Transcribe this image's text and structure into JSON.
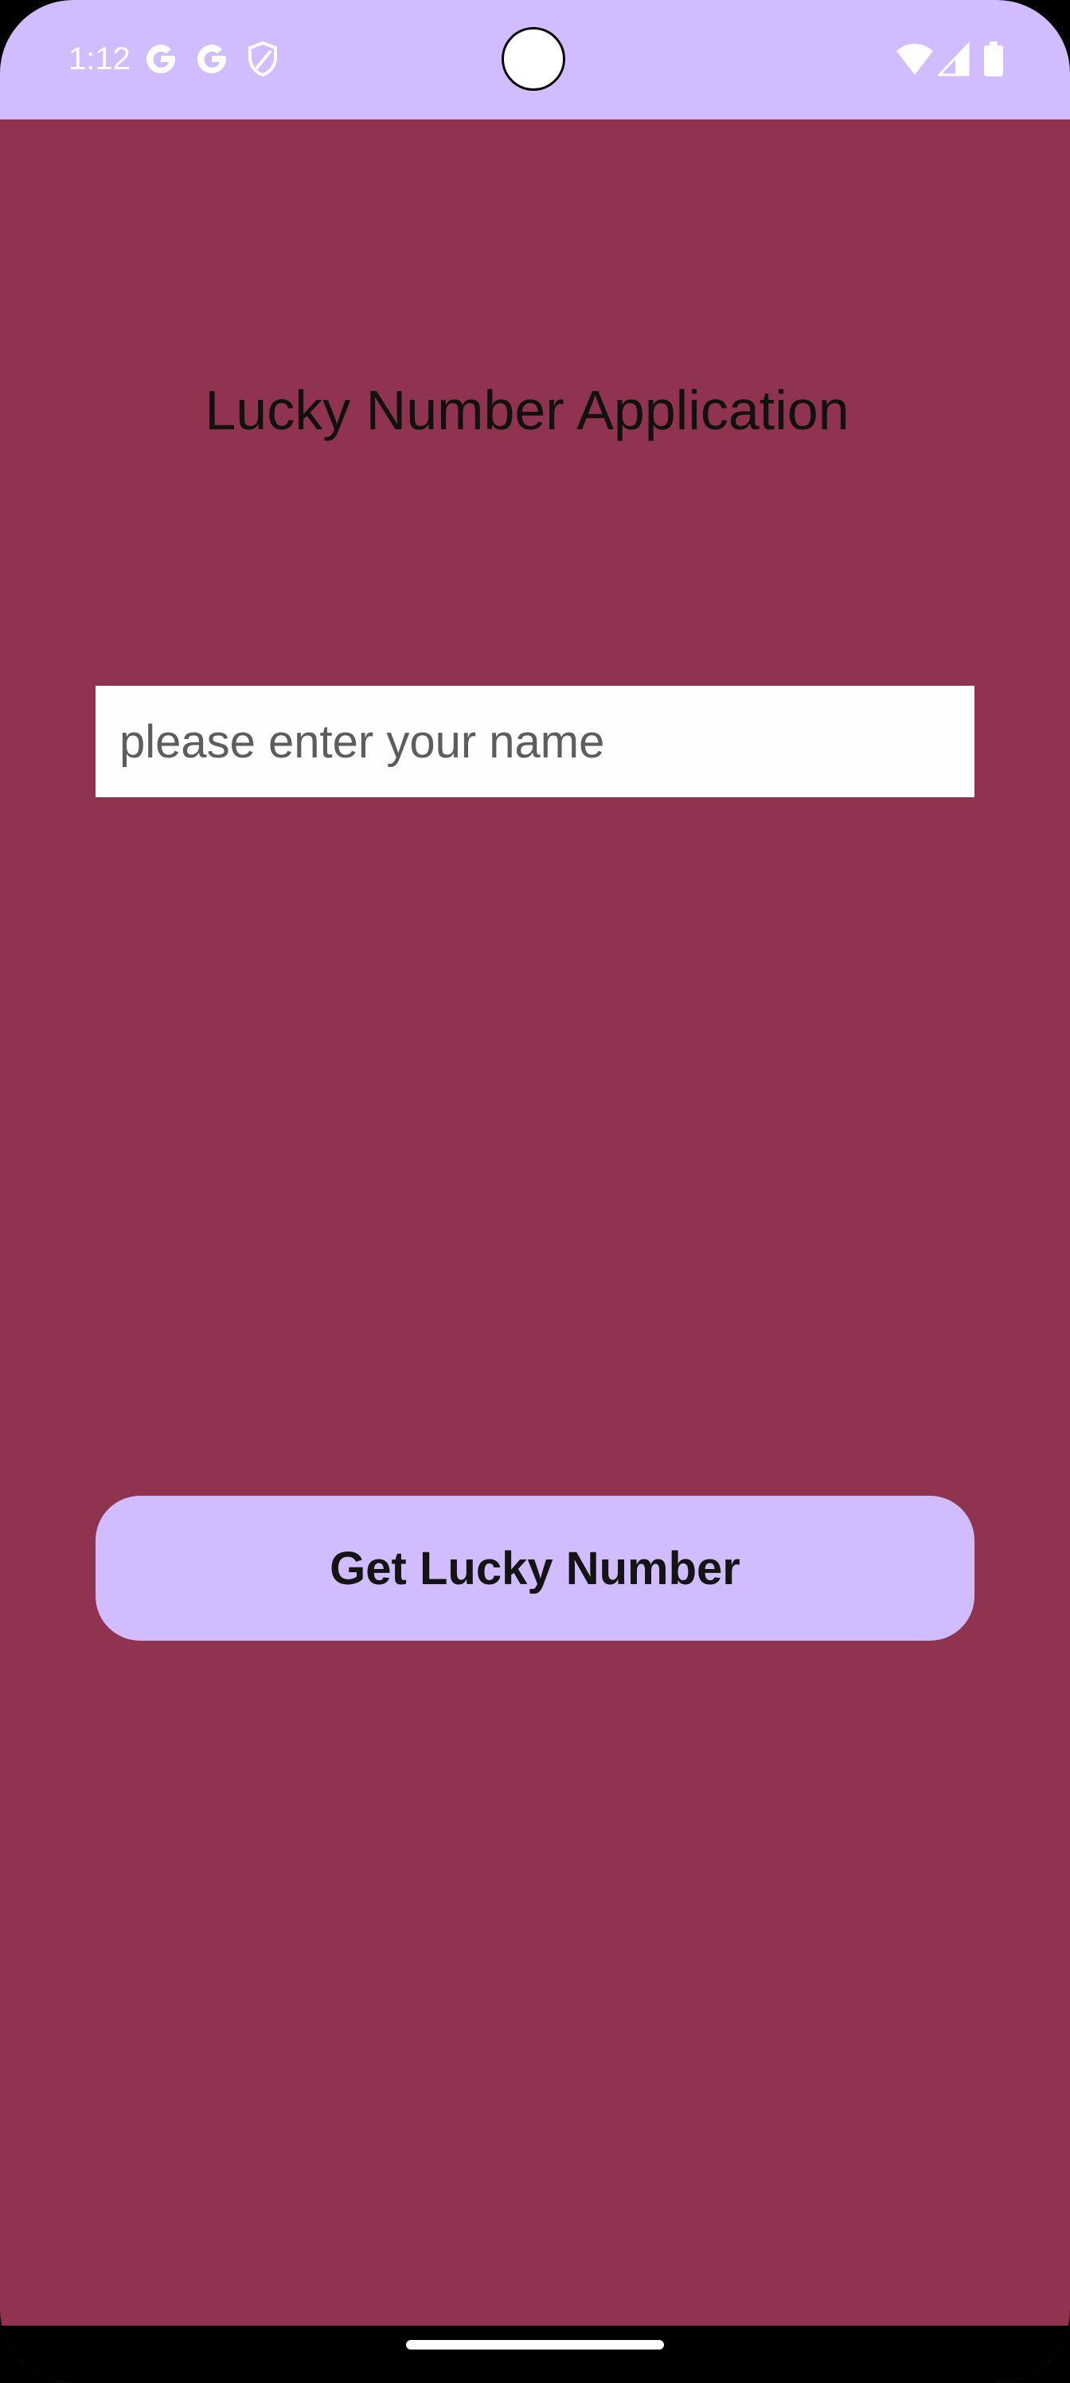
{
  "status_bar": {
    "time": "1:12",
    "background_color": "#d0bcff",
    "icons_left": [
      "google-g-icon",
      "google-g-icon",
      "shield-icon"
    ],
    "icons_right": [
      "wifi-icon",
      "signal-icon",
      "battery-icon"
    ]
  },
  "app": {
    "background_color": "#8f3351",
    "title": "Lucky Number Application",
    "name_input": {
      "value": "",
      "placeholder": "please enter your name"
    },
    "get_number_button": {
      "label": "Get Lucky Number",
      "color": "#d0bcff"
    }
  },
  "nav_bar": {
    "background_color": "#000000"
  }
}
